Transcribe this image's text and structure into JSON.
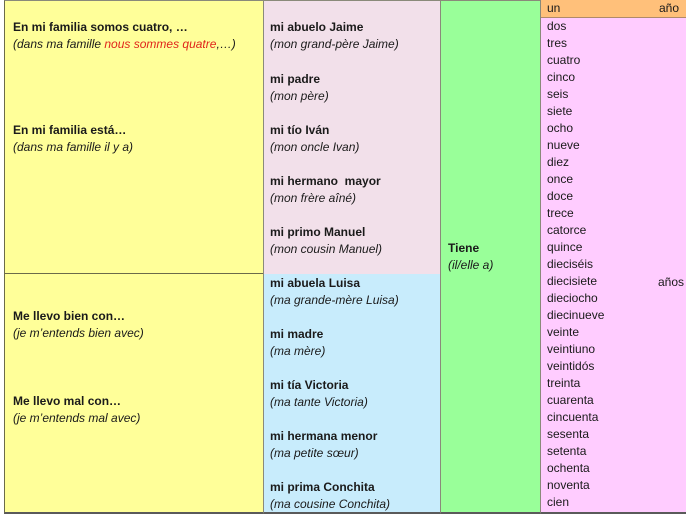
{
  "intro_phrases": [
    {
      "es": "En mi familia somos cuatro, …",
      "fr_prefix": "(dans ma famille ",
      "fr_highlight": "nous sommes quatre",
      "fr_suffix": ",…)"
    },
    {
      "es": "En mi familia está…",
      "fr": "(dans ma famille il y a)"
    }
  ],
  "relation_phrases": [
    {
      "es": "Me llevo bien con…",
      "fr": "(je m’entends bien avec)"
    },
    {
      "es": "Me llevo mal con…",
      "fr": "(je m’entends mal avec)"
    }
  ],
  "male_members": [
    {
      "es": "mi abuelo Jaime",
      "fr": "(mon grand-père Jaime)"
    },
    {
      "es": "mi padre",
      "fr": "(mon père)"
    },
    {
      "es": "mi tío Iván",
      "fr": "(mon oncle Ivan)"
    },
    {
      "es": "mi hermano  mayor",
      "fr": "(mon frère aîné)"
    },
    {
      "es": "mi primo Manuel",
      "fr": "(mon cousin Manuel)"
    }
  ],
  "female_members": [
    {
      "es": "mi abuela Luisa",
      "fr": "(ma grande-mère Luisa)"
    },
    {
      "es": "mi madre",
      "fr": "(ma mère)"
    },
    {
      "es": "mi tía Victoria",
      "fr": "(ma tante Victoria)"
    },
    {
      "es": "mi hermana menor",
      "fr": "(ma petite sœur)"
    },
    {
      "es": "mi prima Conchita",
      "fr": "(ma cousine Conchita)"
    }
  ],
  "verb": {
    "es": "Tiene",
    "fr": "(il/elle a)"
  },
  "age": {
    "header_number": "un",
    "header_unit": "año",
    "plural_unit": "años",
    "numbers": [
      "dos",
      "tres",
      "cuatro",
      "cinco",
      "seis",
      "siete",
      "ocho",
      "nueve",
      "diez",
      "once",
      "doce",
      "trece",
      "catorce",
      "quince",
      "dieciséis",
      "diecisiete",
      "dieciocho",
      "diecinueve",
      "veinte",
      "veintiuno",
      "veintidós",
      "treinta",
      "cuarenta",
      "cincuenta",
      "sesenta",
      "setenta",
      "ochenta",
      "noventa",
      "cien"
    ]
  },
  "colors": {
    "phrases_bg": "#ffff99",
    "male_bg": "#f2e0ea",
    "female_bg": "#c8ecfc",
    "verb_bg": "#99ff99",
    "numbers_bg": "#ffccff",
    "header_bg": "#ffc07a",
    "highlight_text": "#e0251b"
  }
}
